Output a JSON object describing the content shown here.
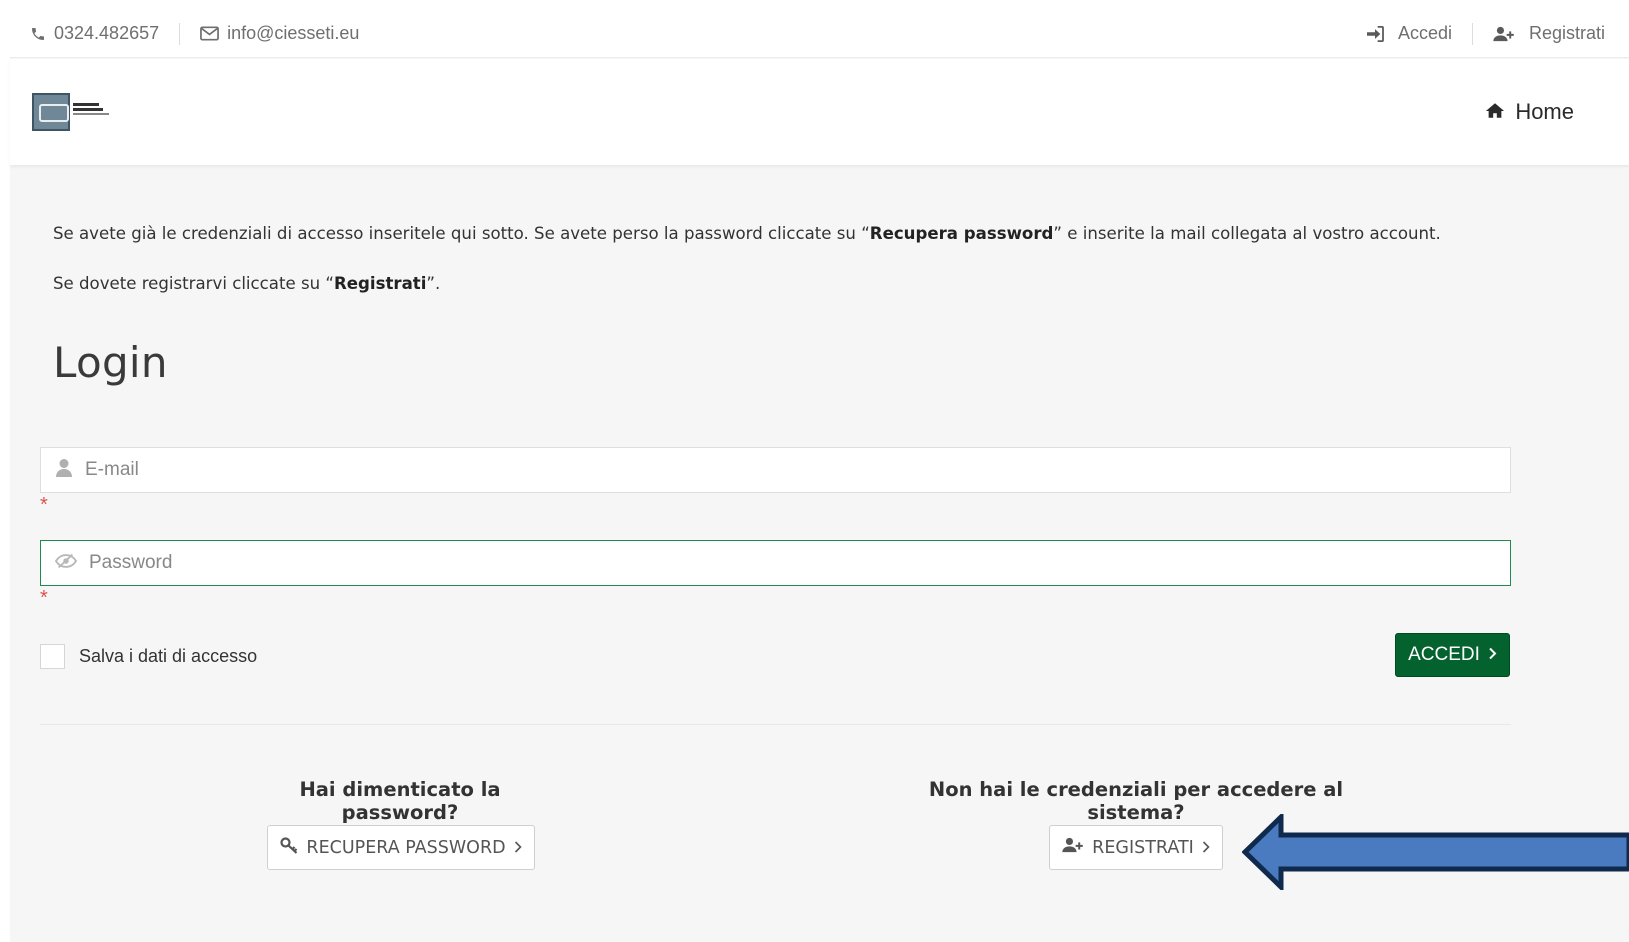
{
  "topbar": {
    "phone": "0324.482657",
    "email": "info@ciesseti.eu",
    "login_label": "Accedi",
    "register_label": "Registrati"
  },
  "header": {
    "home_label": "Home"
  },
  "intro": {
    "line1_pre": "Se avete già le credenziali di accesso inseritele qui sotto. Se avete perso la password cliccate su “",
    "line1_bold": "Recupera password",
    "line1_post": "” e inserite la mail collegata al vostro account.",
    "line2_pre": "Se dovete registrarvi cliccate su “",
    "line2_bold": "Registrati",
    "line2_post": "”."
  },
  "login": {
    "title": "Login",
    "email_placeholder": "E-mail",
    "password_placeholder": "Password",
    "required_mark": "*",
    "remember_label": "Salva i dati di accesso",
    "submit_label": "ACCEDI"
  },
  "forgot": {
    "title": "Hai dimenticato la password?",
    "button_label": "RECUPERA PASSWORD"
  },
  "register": {
    "title": "Non hai le credenziali per accedere al sistema?",
    "button_label": "REGISTRATI"
  },
  "colors": {
    "primary_green": "#03622e",
    "focus_green": "#1d8a50",
    "arrow_blue": "#4a7ac0",
    "arrow_border": "#0f2a4d",
    "required_red": "#d9534f"
  },
  "icons": {
    "phone": "phone-icon",
    "email": "envelope-icon",
    "login": "sign-in-icon",
    "register": "user-plus-icon",
    "home": "home-icon",
    "user": "user-icon",
    "password": "eye-slash-icon",
    "chevron": "chevron-right-icon",
    "key": "key-icon"
  }
}
